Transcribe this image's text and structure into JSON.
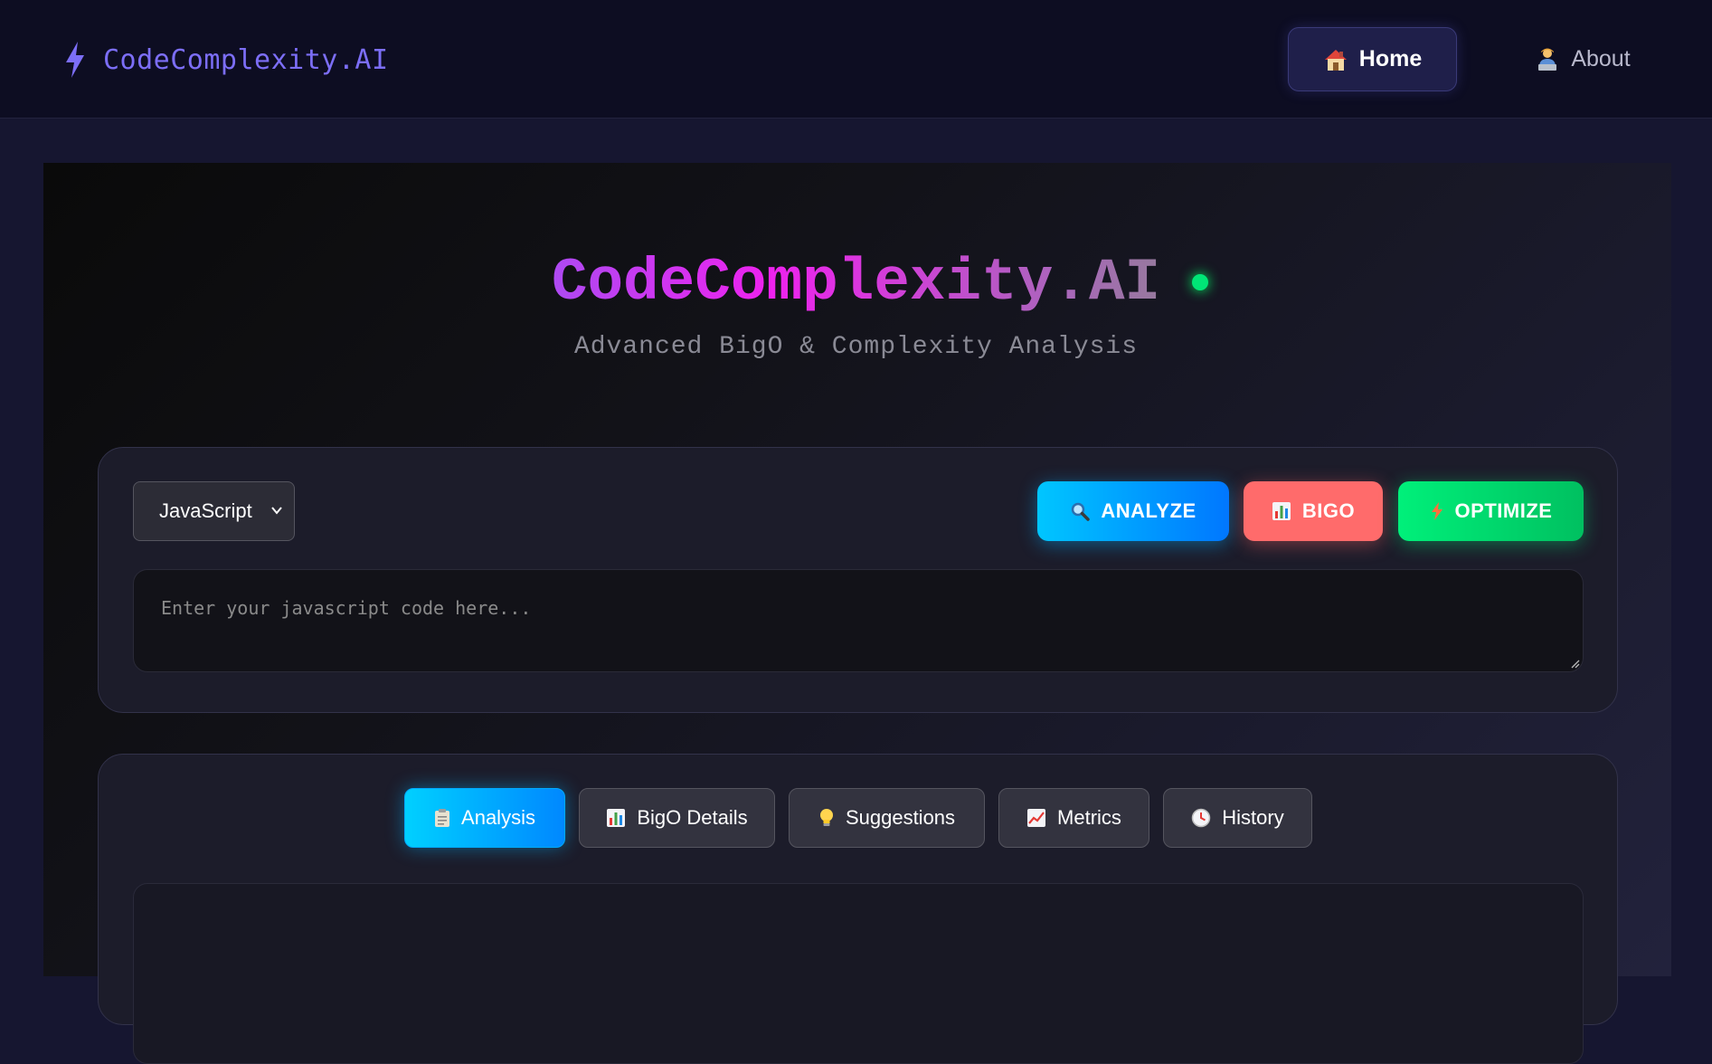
{
  "nav": {
    "brand": "CodeComplexity.AI",
    "home_label": "Home",
    "about_label": "About",
    "home_icon": "house-icon",
    "about_icon": "person-laptop-icon"
  },
  "hero": {
    "title": "CodeComplexity.AI",
    "subtitle": "Advanced BigO & Complexity Analysis"
  },
  "editor": {
    "language": "JavaScript",
    "placeholder": "Enter your javascript code here...",
    "actions": {
      "analyze": "ANALYZE",
      "bigo": "BIGO",
      "optimize": "OPTIMIZE"
    }
  },
  "tabs": [
    {
      "label": "Analysis",
      "icon": "clipboard-icon",
      "active": true
    },
    {
      "label": "BigO Details",
      "icon": "bar-chart-icon",
      "active": false
    },
    {
      "label": "Suggestions",
      "icon": "lightbulb-icon",
      "active": false
    },
    {
      "label": "Metrics",
      "icon": "trending-up-icon",
      "active": false
    },
    {
      "label": "History",
      "icon": "clock-icon",
      "active": false
    }
  ],
  "colors": {
    "accent": "#7c6ef7",
    "analyze": "#00b4ff",
    "bigo": "#ff6b6b",
    "optimize": "#00e676",
    "status": "#00e676"
  }
}
